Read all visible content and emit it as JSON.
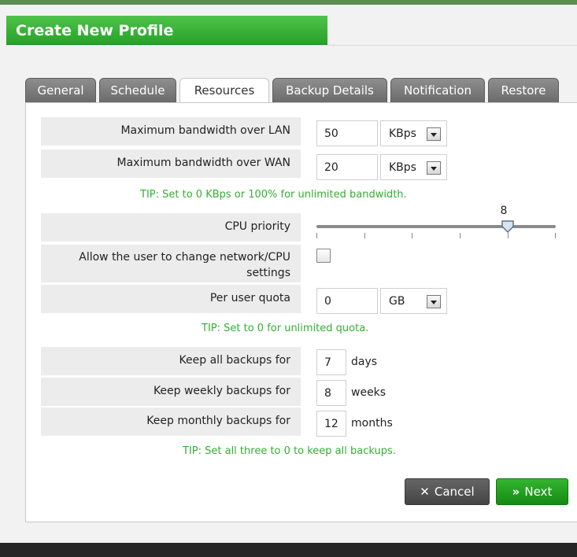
{
  "title": "Create New Profile",
  "tabs": [
    {
      "label": "General"
    },
    {
      "label": "Schedule"
    },
    {
      "label": "Resources",
      "active": true
    },
    {
      "label": "Backup Details"
    },
    {
      "label": "Notification"
    },
    {
      "label": "Restore"
    }
  ],
  "bandwidth": {
    "lan_label": "Maximum bandwidth over LAN",
    "lan_value": "50",
    "lan_unit": "KBps",
    "wan_label": "Maximum bandwidth over WAN",
    "wan_value": "20",
    "wan_unit": "KBps",
    "tip": "TIP: Set to 0 KBps or 100% for unlimited bandwidth."
  },
  "cpu": {
    "label": "CPU priority",
    "value": "8"
  },
  "allow_change": {
    "label_line1": "Allow the user to change network/CPU",
    "label_line2": "settings",
    "checked": false
  },
  "quota": {
    "label": "Per user quota",
    "value": "0",
    "unit": "GB",
    "tip": "TIP: Set to 0 for unlimited quota."
  },
  "retention": {
    "all_label": "Keep all backups for",
    "all_value": "7",
    "all_unit": "days",
    "weekly_label": "Keep weekly backups for",
    "weekly_value": "8",
    "weekly_unit": "weeks",
    "monthly_label": "Keep monthly backups for",
    "monthly_value": "12",
    "monthly_unit": "months",
    "tip": "TIP: Set all three to 0 to keep all backups."
  },
  "buttons": {
    "cancel": "Cancel",
    "next": "Next"
  },
  "colors": {
    "accent_green": "#27a228",
    "tip_green": "#32b032",
    "tab_inactive": "#7a7a7a"
  }
}
